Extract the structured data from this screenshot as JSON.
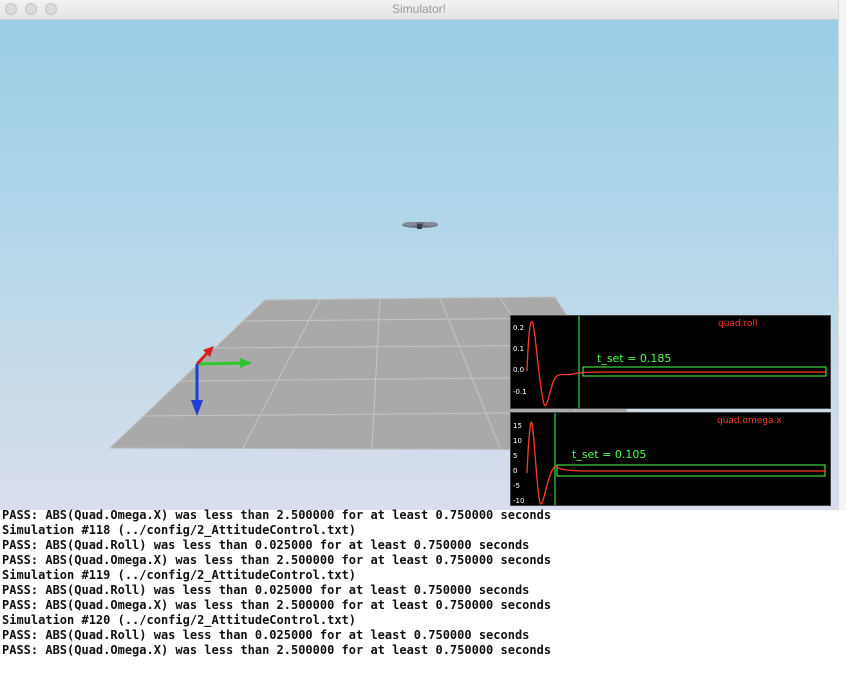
{
  "window": {
    "title": "Simulator!"
  },
  "plots": [
    {
      "title": "quad.roll",
      "ticks": [
        "0.2",
        "0.1",
        "0.0",
        "-0.1"
      ],
      "tset_label": "t_set  =  0.185"
    },
    {
      "title": "quad.omega.x",
      "ticks": [
        "15",
        "10",
        "5",
        "0",
        "-5",
        "-10"
      ],
      "tset_label": "t_set  =  0.105"
    }
  ],
  "colors": {
    "trace": "#ff3a2a",
    "threshold": "#4dff4d",
    "sky_top": "#9bcde6",
    "ground": "#a9a9a9"
  },
  "console": {
    "lines": [
      "PASS: ABS(Quad.Omega.X) was less than 2.500000 for at least 0.750000 seconds",
      "Simulation #118 (../config/2_AttitudeControl.txt)",
      "PASS: ABS(Quad.Roll) was less than 0.025000 for at least 0.750000 seconds",
      "PASS: ABS(Quad.Omega.X) was less than 2.500000 for at least 0.750000 seconds",
      "Simulation #119 (../config/2_AttitudeControl.txt)",
      "PASS: ABS(Quad.Roll) was less than 0.025000 for at least 0.750000 seconds",
      "PASS: ABS(Quad.Omega.X) was less than 2.500000 for at least 0.750000 seconds",
      "Simulation #120 (../config/2_AttitudeControl.txt)",
      "PASS: ABS(Quad.Roll) was less than 0.025000 for at least 0.750000 seconds",
      "PASS: ABS(Quad.Omega.X) was less than 2.500000 for at least 0.750000 seconds"
    ]
  }
}
